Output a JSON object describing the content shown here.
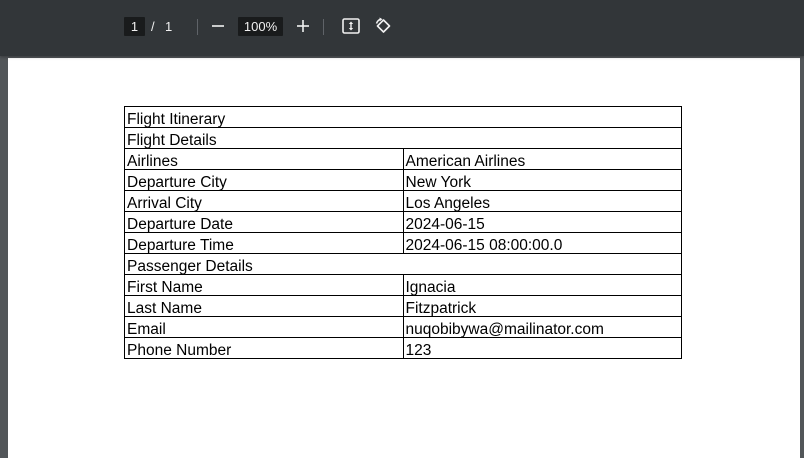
{
  "toolbar": {
    "current_page": "1",
    "page_separator": "/",
    "total_pages": "1",
    "zoom": "100%",
    "icons": {
      "zoom_out": "minus-icon",
      "zoom_in": "plus-icon",
      "fit_page": "fit-to-page-icon",
      "rotate": "rotate-icon"
    }
  },
  "document": {
    "title": "Flight Itinerary",
    "flight_section": "Flight Details",
    "flight_rows": [
      {
        "label": "Airlines",
        "value": "American Airlines"
      },
      {
        "label": "Departure City",
        "value": "New York"
      },
      {
        "label": "Arrival City",
        "value": "Los Angeles"
      },
      {
        "label": "Departure Date",
        "value": "2024-06-15"
      },
      {
        "label": "Departure Time",
        "value": "2024-06-15 08:00:00.0"
      }
    ],
    "passenger_section": "Passenger Details",
    "passenger_rows": [
      {
        "label": "First Name",
        "value": "Ignacia"
      },
      {
        "label": "Last Name",
        "value": "Fitzpatrick"
      },
      {
        "label": "Email",
        "value": "nuqobibywa@mailinator.com"
      },
      {
        "label": "Phone Number",
        "value": "123"
      }
    ]
  },
  "colors": {
    "toolbar_bg": "#323639",
    "viewer_bg": "#525659",
    "page_bg": "#ffffff",
    "input_bg": "#191b1c"
  }
}
